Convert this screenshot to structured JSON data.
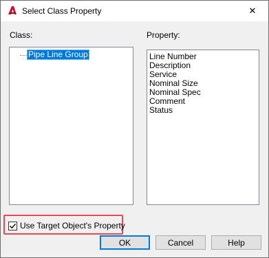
{
  "window": {
    "title": "Select Class Property",
    "close_glyph": "✕"
  },
  "class_section": {
    "label": "Class:",
    "tree_items": [
      {
        "label": "Pipe Line Group",
        "selected": true
      }
    ]
  },
  "property_section": {
    "label": "Property:",
    "items": [
      "Line Number",
      "Description",
      "Service",
      "Nominal Size",
      "Nominal Spec",
      "Comment",
      "Status"
    ]
  },
  "options": {
    "use_target_label": "Use Target Object's Property",
    "use_target_checked": true
  },
  "buttons": {
    "ok": "OK",
    "cancel": "Cancel",
    "help": "Help"
  },
  "colors": {
    "selection": "#0078d7",
    "highlight_frame": "#e8484f",
    "app_icon": "#c8102e"
  }
}
